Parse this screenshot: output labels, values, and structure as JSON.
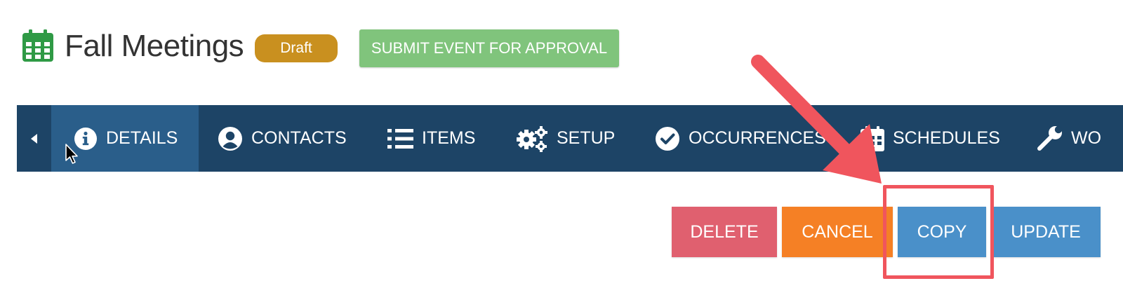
{
  "header": {
    "title": "Fall Meetings",
    "status": "Draft",
    "submit_label": "SUBMIT EVENT FOR APPROVAL",
    "title_icon": "calendar-icon"
  },
  "colors": {
    "calendar_icon": "#2f9a45",
    "badge": "#c9901f",
    "submit": "#80c47c",
    "navbar": "#1d4466",
    "nav_active": "#2a5e8a",
    "delete": "#e0606f",
    "cancel": "#f58025",
    "copy": "#4a90c9",
    "update": "#4a90c9",
    "annotation": "#f0555d"
  },
  "nav": {
    "prev_icon": "caret-left-icon",
    "tabs": [
      {
        "label": "DETAILS",
        "icon": "info-circle-icon",
        "active": true
      },
      {
        "label": "CONTACTS",
        "icon": "user-circle-icon"
      },
      {
        "label": "ITEMS",
        "icon": "list-icon"
      },
      {
        "label": "SETUP",
        "icon": "gears-icon"
      },
      {
        "label": "OCCURRENCES",
        "icon": "check-circle-icon"
      },
      {
        "label": "SCHEDULES",
        "icon": "calendar-icon"
      },
      {
        "label": "WO",
        "icon": "wrench-icon"
      }
    ]
  },
  "actions": {
    "delete": "DELETE",
    "cancel": "CANCEL",
    "copy": "COPY",
    "update": "UPDATE"
  }
}
